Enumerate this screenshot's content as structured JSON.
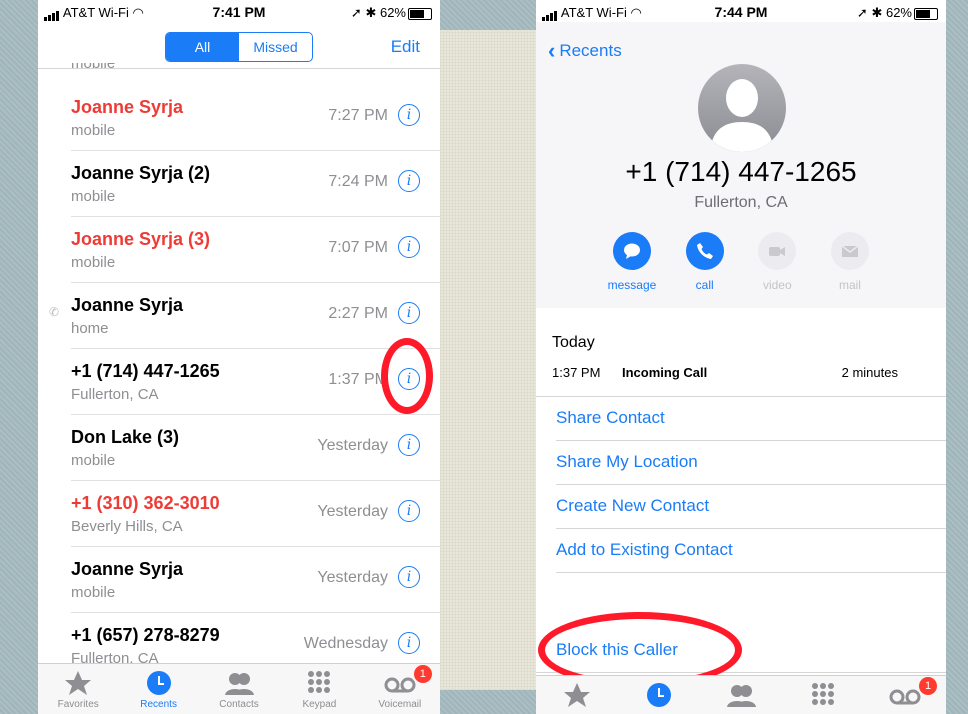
{
  "left": {
    "status": {
      "carrier": "AT&T Wi-Fi",
      "time": "7:41 PM",
      "battery": "62%"
    },
    "segment": {
      "all": "All",
      "missed": "Missed"
    },
    "edit": "Edit",
    "peek_label": "mobile",
    "calls": [
      {
        "name": "Joanne Syrja",
        "sub": "mobile",
        "time": "7:27 PM",
        "missed": true,
        "outgoing": false
      },
      {
        "name": "Joanne Syrja (2)",
        "sub": "mobile",
        "time": "7:24 PM",
        "missed": false,
        "outgoing": false
      },
      {
        "name": "Joanne Syrja (3)",
        "sub": "mobile",
        "time": "7:07 PM",
        "missed": true,
        "outgoing": false
      },
      {
        "name": "Joanne Syrja",
        "sub": "home",
        "time": "2:27 PM",
        "missed": false,
        "outgoing": true
      },
      {
        "name": "+1 (714) 447-1265",
        "sub": "Fullerton, CA",
        "time": "1:37 PM",
        "missed": false,
        "outgoing": false
      },
      {
        "name": "Don Lake (3)",
        "sub": "mobile",
        "time": "Yesterday",
        "missed": false,
        "outgoing": false
      },
      {
        "name": "+1 (310) 362-3010",
        "sub": "Beverly Hills, CA",
        "time": "Yesterday",
        "missed": true,
        "outgoing": false
      },
      {
        "name": "Joanne Syrja",
        "sub": "mobile",
        "time": "Yesterday",
        "missed": false,
        "outgoing": false
      },
      {
        "name": "+1 (657) 278-8279",
        "sub": "Fullerton, CA",
        "time": "Wednesday",
        "missed": false,
        "outgoing": false
      }
    ],
    "tabs": [
      {
        "label": "Favorites",
        "icon": "star-icon"
      },
      {
        "label": "Recents",
        "icon": "clock-icon",
        "active": true
      },
      {
        "label": "Contacts",
        "icon": "contacts-icon"
      },
      {
        "label": "Keypad",
        "icon": "keypad-icon"
      },
      {
        "label": "Voicemail",
        "icon": "voicemail-icon",
        "badge": "1"
      }
    ]
  },
  "right": {
    "status": {
      "carrier": "AT&T Wi-Fi",
      "time": "7:44 PM",
      "battery": "62%"
    },
    "back_label": "Recents",
    "number": "+1 (714) 447-1265",
    "location": "Fullerton, CA",
    "actions": [
      {
        "label": "message",
        "icon": "message-icon",
        "enabled": true
      },
      {
        "label": "call",
        "icon": "phone-icon",
        "enabled": true
      },
      {
        "label": "video",
        "icon": "video-icon",
        "enabled": false
      },
      {
        "label": "mail",
        "icon": "mail-icon",
        "enabled": false
      }
    ],
    "history": {
      "day": "Today",
      "time": "1:37 PM",
      "kind": "Incoming Call",
      "duration": "2 minutes"
    },
    "options": [
      "Share Contact",
      "Share My Location",
      "Create New Contact",
      "Add to Existing Contact"
    ],
    "block": "Block this Caller",
    "badge": "1"
  },
  "colors": {
    "accent": "#1a7cf7",
    "missed": "#ef3b36",
    "annotation": "#ff1a2a"
  }
}
